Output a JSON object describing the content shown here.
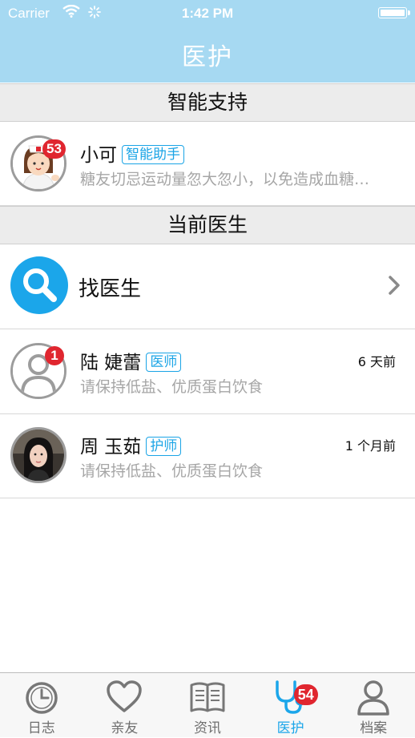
{
  "status_bar": {
    "carrier": "Carrier",
    "time": "1:42 PM"
  },
  "header": {
    "title": "医护"
  },
  "sections": {
    "smart": "智能支持",
    "current": "当前医生"
  },
  "assistant": {
    "name": "小可",
    "tag": "智能助手",
    "message": "糖友切忌运动量忽大忽小，以免造成血糖…",
    "badge": "53"
  },
  "find_doctor": {
    "label": "找医生"
  },
  "doctors": [
    {
      "name": "陆 婕蕾",
      "tag": "医师",
      "message": "请保持低盐、优质蛋白饮食",
      "time": "6 天前",
      "badge": "1"
    },
    {
      "name": "周 玉茹",
      "tag": "护师",
      "message": "请保持低盐、优质蛋白饮食",
      "time": "1 个月前"
    }
  ],
  "tabs": [
    {
      "label": "日志",
      "icon": "clock-icon"
    },
    {
      "label": "亲友",
      "icon": "heart-icon"
    },
    {
      "label": "资讯",
      "icon": "book-icon"
    },
    {
      "label": "医护",
      "icon": "stethoscope-icon",
      "badge": "54",
      "active": true
    },
    {
      "label": "档案",
      "icon": "person-icon"
    }
  ],
  "colors": {
    "header": "#a6d9f2",
    "accent": "#1ba6ea",
    "badge": "#e0262f"
  }
}
